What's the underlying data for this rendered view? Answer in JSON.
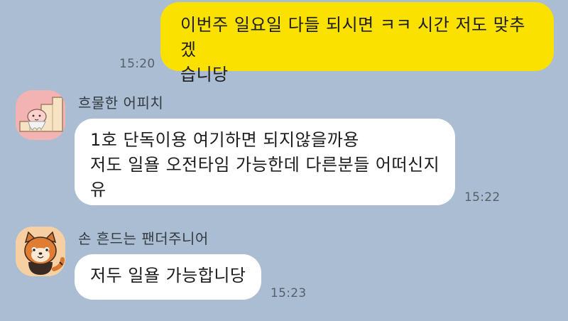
{
  "messages": [
    {
      "side": "mine",
      "text": "이번주 일요일 다들 되시면 ㅋㅋ 시간 저도 맞추겠\n습니당",
      "time": "15:20"
    },
    {
      "side": "theirs",
      "sender": "흐물한 어피치",
      "avatar_icon": "apeach-stairs-icon",
      "text": "1호 단독이용 여기하면 되지않을까용\n저도 일욜 오전타임 가능한데 다른분들 어떠신지\n유",
      "time": "15:22"
    },
    {
      "side": "theirs",
      "sender": "손 흔드는 팬더주니어",
      "avatar_icon": "panda-junior-icon",
      "text": "저두 일욜 가능합니당",
      "time": "15:23"
    }
  ],
  "colors": {
    "background": "#aabdd2",
    "my_bubble": "#fae100",
    "their_bubble": "#ffffff"
  }
}
